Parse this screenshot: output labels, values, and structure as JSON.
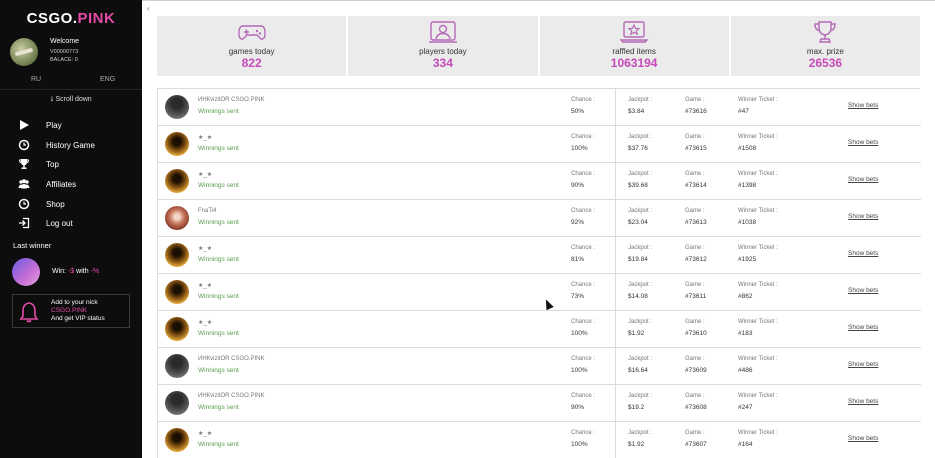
{
  "logo": {
    "part1": "CSGO.",
    "part2": "PINK"
  },
  "user": {
    "welcome": "Welcome",
    "id": "V00000773",
    "balance": "BALACE: 0"
  },
  "languages": {
    "ru": "RU",
    "eng": "ENG"
  },
  "scroll_down": "⭣ Scroll down",
  "nav": [
    {
      "label": "Play",
      "icon": "play-icon"
    },
    {
      "label": "History Game",
      "icon": "clock-icon"
    },
    {
      "label": "Top",
      "icon": "trophy-icon"
    },
    {
      "label": "Affiliates",
      "icon": "users-icon"
    },
    {
      "label": "Shop",
      "icon": "clock-icon"
    },
    {
      "label": "Log out",
      "icon": "logout-icon"
    }
  ],
  "last_winner": {
    "title": "Last winner",
    "win_prefix": "Win: ",
    "win_amount": "-$",
    "with": " with ",
    "percent": "-%"
  },
  "vip": {
    "line1": "Add to your nick",
    "line2": "CSGO.PINK",
    "line3": "And get VIP status"
  },
  "stats": [
    {
      "label": "games today",
      "value": "822",
      "icon": "gamepad-icon"
    },
    {
      "label": "players today",
      "value": "334",
      "icon": "player-icon"
    },
    {
      "label": "raffled items",
      "value": "1063194",
      "icon": "laptop-star-icon"
    },
    {
      "label": "max. prize",
      "value": "26536",
      "icon": "trophy-icon"
    }
  ],
  "labels": {
    "chance": "Chance :",
    "jackpot": "Jackpot :",
    "game": "Game :",
    "ticket": "Winner Ticket :",
    "show_bets": "Show bets"
  },
  "games": [
    {
      "name": "ИНКvizitOR CSGO.PINK",
      "status": "Winnings sent",
      "avatar": "hood",
      "chance": "50%",
      "jackpot": "$3.84",
      "game": "#73616",
      "ticket": "#47"
    },
    {
      "name": "★_★",
      "status": "Winnings sent",
      "avatar": "gold",
      "chance": "100%",
      "jackpot": "$37.76",
      "game": "#73615",
      "ticket": "#1508"
    },
    {
      "name": "★_★",
      "status": "Winnings sent",
      "avatar": "gold",
      "chance": "90%",
      "jackpot": "$39.68",
      "game": "#73614",
      "ticket": "#1398"
    },
    {
      "name": "FnaTi4",
      "status": "Winnings sent",
      "avatar": "fnat",
      "chance": "92%",
      "jackpot": "$23.04",
      "game": "#73613",
      "ticket": "#1038"
    },
    {
      "name": "★_★",
      "status": "Winnings sent",
      "avatar": "gold",
      "chance": "81%",
      "jackpot": "$19.84",
      "game": "#73612",
      "ticket": "#1925"
    },
    {
      "name": "★_★",
      "status": "Winnings sent",
      "avatar": "gold",
      "chance": "73%",
      "jackpot": "$14.08",
      "game": "#73611",
      "ticket": "#862"
    },
    {
      "name": "★_★",
      "status": "Winnings sent",
      "avatar": "gold",
      "chance": "100%",
      "jackpot": "$1.92",
      "game": "#73610",
      "ticket": "#183"
    },
    {
      "name": "ИНКvizitOR CSGO.PINK",
      "status": "Winnings sent",
      "avatar": "hood",
      "chance": "100%",
      "jackpot": "$16.64",
      "game": "#73609",
      "ticket": "#486"
    },
    {
      "name": "ИНКvizitOR CSGO.PINK",
      "status": "Winnings sent",
      "avatar": "hood",
      "chance": "90%",
      "jackpot": "$19.2",
      "game": "#73608",
      "ticket": "#247"
    },
    {
      "name": "★_★",
      "status": "Winnings sent",
      "avatar": "gold",
      "chance": "100%",
      "jackpot": "$1.92",
      "game": "#73607",
      "ticket": "#164"
    }
  ],
  "colors": {
    "accent": "#e44aa6",
    "stat_value": "#c64ab9",
    "sent": "#5a9d4e",
    "sidebar": "#0d0d0d"
  }
}
